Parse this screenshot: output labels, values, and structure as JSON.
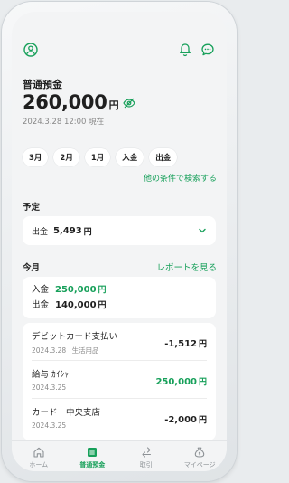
{
  "account": {
    "title": "普通預金",
    "balance": "260,000",
    "currency": "円",
    "as_of": "2024.3.28 12:00 現在"
  },
  "filters": {
    "chips": [
      "3月",
      "2月",
      "1月",
      "入金",
      "出金"
    ],
    "search_link": "他の条件で検索する"
  },
  "scheduled": {
    "section_label": "予定",
    "label": "出金",
    "amount": "5,493",
    "currency": "円"
  },
  "this_month": {
    "section_label": "今月",
    "report_link": "レポートを見る",
    "deposit_label": "入金",
    "deposit_amount": "250,000",
    "withdraw_label": "出金",
    "withdraw_amount": "140,000",
    "currency": "円"
  },
  "transactions": [
    {
      "name": "デビットカード支払い",
      "date": "2024.3.28",
      "category": "生活用品",
      "amount": "-1,512",
      "currency": "円",
      "type": "debit"
    },
    {
      "name": "給与 ｶｲｼｬ",
      "date": "2024.3.25",
      "category": "",
      "amount": "250,000",
      "currency": "円",
      "type": "credit"
    },
    {
      "name": "カード　中央支店",
      "date": "2024.3.25",
      "category": "",
      "amount": "-2,000",
      "currency": "円",
      "type": "debit"
    }
  ],
  "tabbar": {
    "tabs": [
      {
        "label": "ホーム",
        "icon": "home-icon"
      },
      {
        "label": "普通預金",
        "icon": "list-icon"
      },
      {
        "label": "取引",
        "icon": "transfer-icon"
      },
      {
        "label": "マイページ",
        "icon": "moneybag-icon"
      }
    ],
    "active_index": 1
  },
  "colors": {
    "accent": "#17a05a",
    "background": "#f3f4f5",
    "card": "#ffffff"
  }
}
